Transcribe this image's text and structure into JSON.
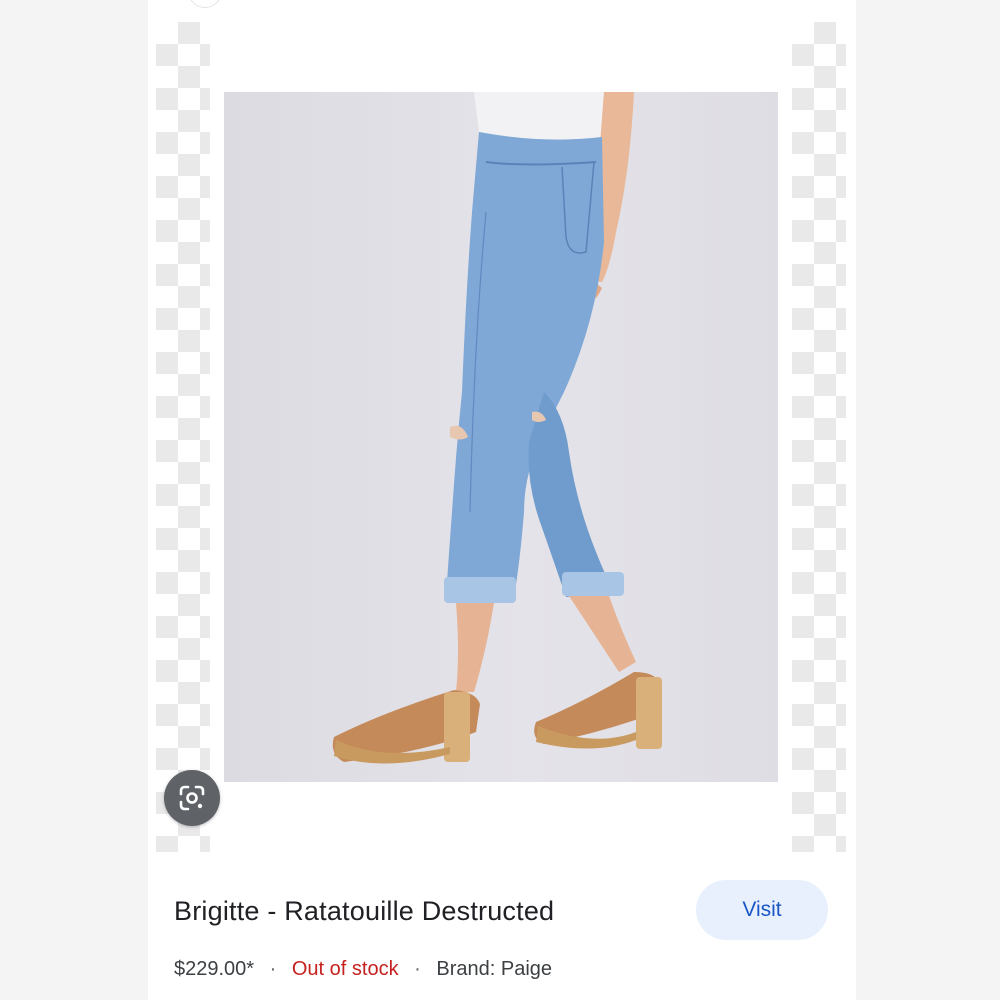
{
  "product": {
    "title": "Brigitte - Ratatouille Destructed",
    "price": "$229.00*",
    "separator": "·",
    "stock_status": "Out of stock",
    "brand": "Brand: Paige",
    "visit_label": "Visit"
  },
  "image": {
    "subject": "light-wash cropped jeans with platform sandals"
  },
  "icons": {
    "lens": "google-lens-icon"
  },
  "colors": {
    "visit_button_bg": "#e8f0fe",
    "visit_button_text": "#1a56c4",
    "out_of_stock": "#c5221f",
    "lens_button_bg": "#5f6368"
  }
}
